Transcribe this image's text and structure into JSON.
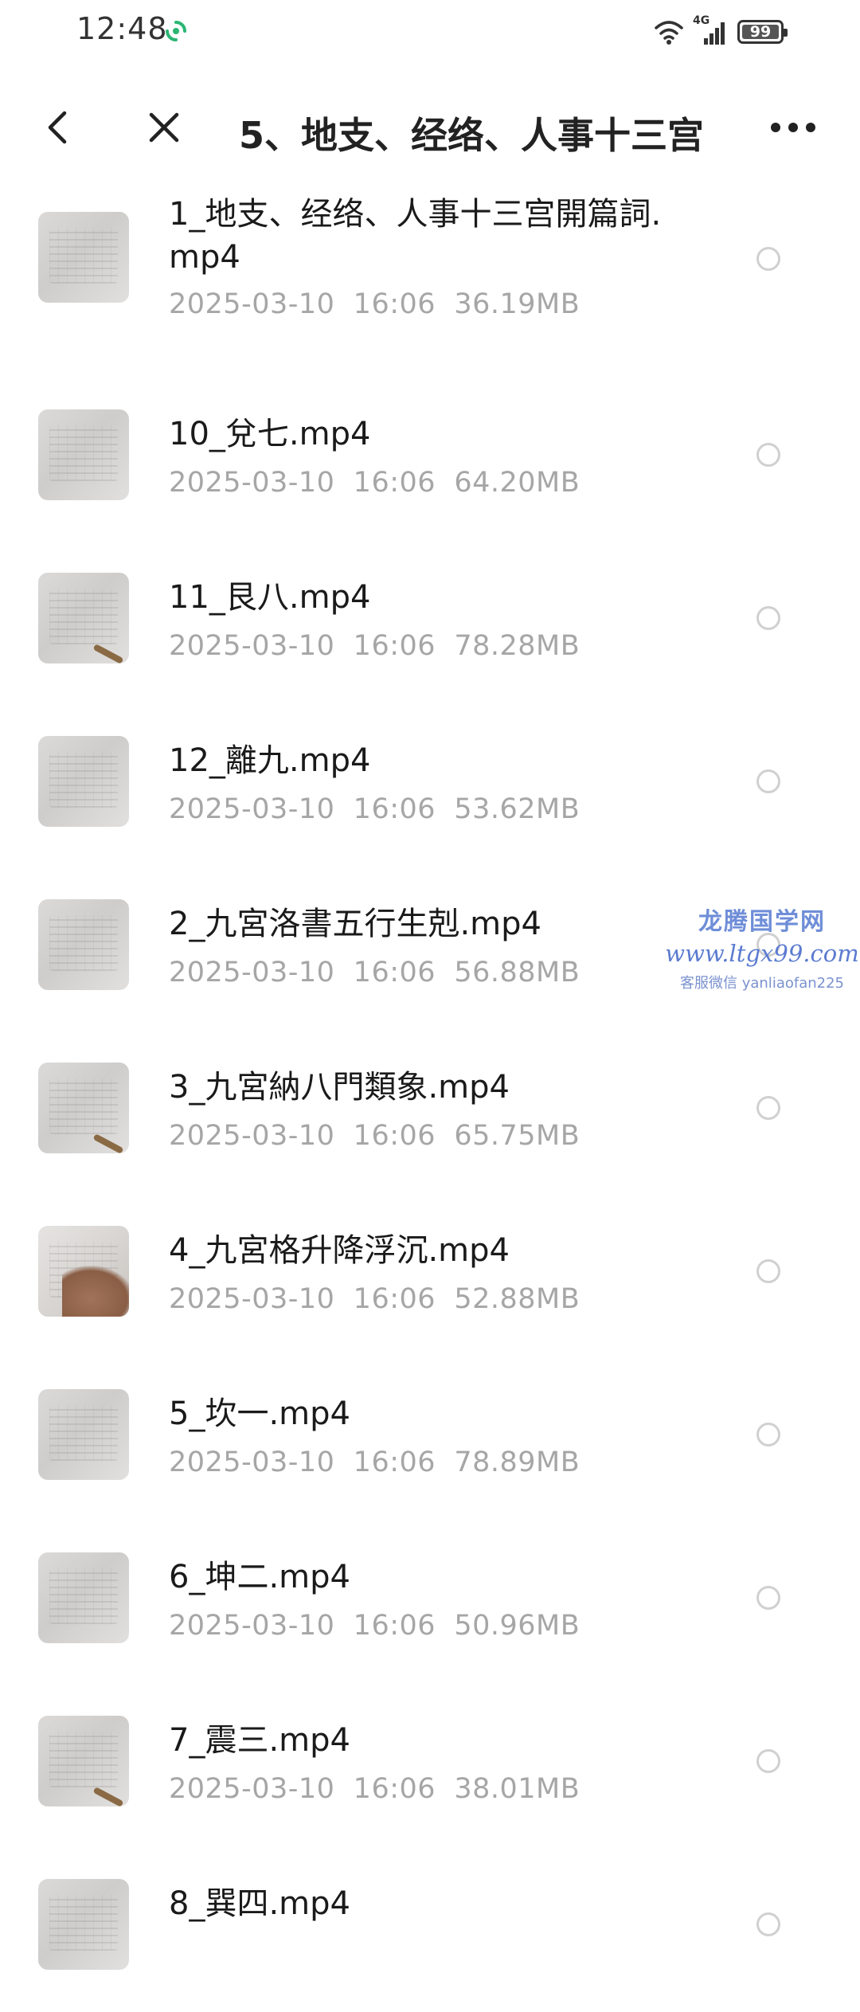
{
  "status_bar": {
    "time": "12:48",
    "network": "4G",
    "battery": "99",
    "battery_level": 0.99
  },
  "header": {
    "title": "5、地支、经络、人事十三宫"
  },
  "files": [
    {
      "name": "1_地支、经络、人事十三宫開篇詞.mp4",
      "date": "2025-03-10",
      "time": "16:06",
      "size": "36.19MB",
      "thumb": "plain"
    },
    {
      "name": "10_兌七.mp4",
      "date": "2025-03-10",
      "time": "16:06",
      "size": "64.20MB",
      "thumb": "plain"
    },
    {
      "name": "11_艮八.mp4",
      "date": "2025-03-10",
      "time": "16:06",
      "size": "78.28MB",
      "thumb": "pen"
    },
    {
      "name": "12_離九.mp4",
      "date": "2025-03-10",
      "time": "16:06",
      "size": "53.62MB",
      "thumb": "plain"
    },
    {
      "name": "2_九宮洛書五行生剋.mp4",
      "date": "2025-03-10",
      "time": "16:06",
      "size": "56.88MB",
      "thumb": "plain"
    },
    {
      "name": "3_九宮納八門類象.mp4",
      "date": "2025-03-10",
      "time": "16:06",
      "size": "65.75MB",
      "thumb": "pen"
    },
    {
      "name": "4_九宮格升降浮沉.mp4",
      "date": "2025-03-10",
      "time": "16:06",
      "size": "52.88MB",
      "thumb": "hand"
    },
    {
      "name": "5_坎一.mp4",
      "date": "2025-03-10",
      "time": "16:06",
      "size": "78.89MB",
      "thumb": "plain"
    },
    {
      "name": "6_坤二.mp4",
      "date": "2025-03-10",
      "time": "16:06",
      "size": "50.96MB",
      "thumb": "plain"
    },
    {
      "name": "7_震三.mp4",
      "date": "2025-03-10",
      "time": "16:06",
      "size": "38.01MB",
      "thumb": "pen"
    },
    {
      "name": "8_巽四.mp4",
      "date": "",
      "time": "",
      "size": "",
      "thumb": "plain"
    }
  ],
  "watermark": {
    "title": "龙腾国学网",
    "url": "www.ltgx99.com",
    "contact": "客服微信 yanliaofan225"
  },
  "colors": {
    "text_primary": "#1a1a1a",
    "text_secondary": "#a6a6a6",
    "radio_border": "#d0d0d0",
    "watermark": "#5b7bd0"
  }
}
